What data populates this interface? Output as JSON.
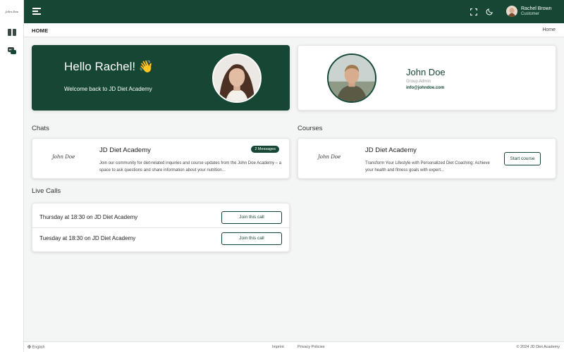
{
  "app": {
    "logo_text": "John Doe"
  },
  "header": {
    "user_name": "Rachel Brown",
    "user_role": "Customer"
  },
  "breadcrumb": {
    "title": "HOME",
    "home_link": "Home"
  },
  "welcome": {
    "greeting": "Hello Rachel! 👋",
    "subtitle": "Welcome back to JD Diet Academy"
  },
  "profile": {
    "name": "John Doe",
    "role": "Group Admin",
    "email": "info@johndoe.com"
  },
  "chats": {
    "section_title": "Chats",
    "items": [
      {
        "signature": "John Doe",
        "title": "JD Diet Academy",
        "badge": "2 Messages",
        "description": "Join our community for diet-related inquiries and course updates from the John Doe Academy – a space to ask questions and share information about your nutrition..."
      }
    ]
  },
  "courses": {
    "section_title": "Courses",
    "items": [
      {
        "signature": "John Doe",
        "title": "JD Diet Academy",
        "description": "Transform Your Lifestyle with Personalized Diet Coaching: Achieve your health and fitness goals with expert...",
        "button_label": "Start course"
      }
    ]
  },
  "live_calls": {
    "section_title": "Live Calls",
    "items": [
      {
        "text": "Thursday at 18:30 on JD Diet Academy",
        "button_label": "Join this call"
      },
      {
        "text": "Tuesday at 18:30 on JD Diet Academy",
        "button_label": "Join this call"
      }
    ]
  },
  "footer": {
    "language": "English",
    "imprint": "Imprint",
    "privacy": "Privacy Policies",
    "copyright": "© 2024 JD Diet Academy"
  },
  "colors": {
    "brand": "#154734",
    "background": "#f4f5f5",
    "card": "#ffffff"
  },
  "icons": [
    "menu-icon",
    "fullscreen-icon",
    "moon-icon",
    "book-icon",
    "chat-icon",
    "globe-icon"
  ]
}
